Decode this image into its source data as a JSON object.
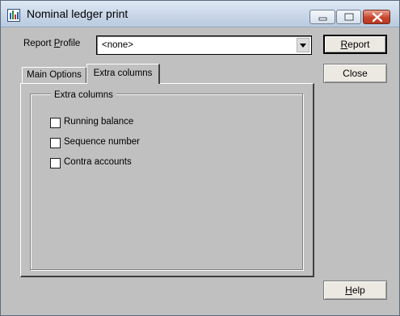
{
  "window": {
    "title": "Nominal ledger print",
    "controls": {
      "minimize": "minimize",
      "maximize": "maximize",
      "close": "close"
    }
  },
  "report_profile": {
    "label_pre": "Report ",
    "label_mnemonic": "P",
    "label_post": "rofile",
    "value": "<none>"
  },
  "buttons": {
    "report_pre": "",
    "report_mnemonic": "R",
    "report_post": "eport",
    "close": "Close",
    "help_mnemonic": "H",
    "help_post": "elp"
  },
  "tabs": [
    {
      "label": "Main Options",
      "active": false
    },
    {
      "label": "Extra columns",
      "active": true
    }
  ],
  "extra_columns": {
    "group_title": "Extra columns",
    "options": [
      {
        "label": "Running balance",
        "checked": false
      },
      {
        "label": "Sequence number",
        "checked": false
      },
      {
        "label": "Contra accounts",
        "checked": false
      }
    ]
  },
  "colors": {
    "dialog_background": "#c0c0c0",
    "titlebar": "#c9d7e8",
    "close_button": "#c9452d"
  }
}
